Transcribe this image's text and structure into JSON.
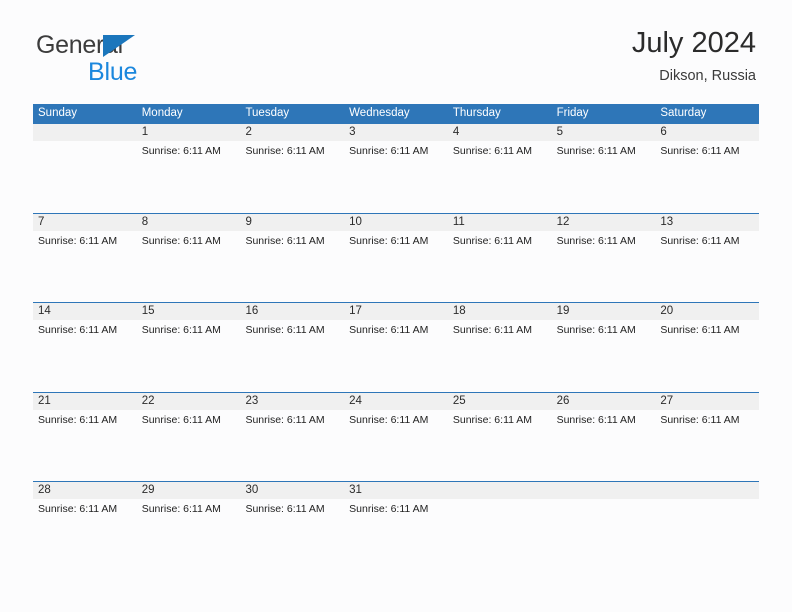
{
  "brand": {
    "line1": "General",
    "line2": "Blue",
    "triangle_color": "#1b76bc",
    "blue_text_color": "#1b87dd"
  },
  "header": {
    "title": "July 2024",
    "subtitle": "Dikson, Russia"
  },
  "colors": {
    "header_blue": "#2e76b8",
    "daynum_band": "#f0f0f0",
    "page_background": "#fcfcfd",
    "text": "#2b2b2b"
  },
  "calendar": {
    "weekday_headers": [
      "Sunday",
      "Monday",
      "Tuesday",
      "Wednesday",
      "Thursday",
      "Friday",
      "Saturday"
    ],
    "weeks": [
      {
        "days": [
          {
            "num": "",
            "event": ""
          },
          {
            "num": "1",
            "event": "Sunrise: 6:11 AM"
          },
          {
            "num": "2",
            "event": "Sunrise: 6:11 AM"
          },
          {
            "num": "3",
            "event": "Sunrise: 6:11 AM"
          },
          {
            "num": "4",
            "event": "Sunrise: 6:11 AM"
          },
          {
            "num": "5",
            "event": "Sunrise: 6:11 AM"
          },
          {
            "num": "6",
            "event": "Sunrise: 6:11 AM"
          }
        ]
      },
      {
        "days": [
          {
            "num": "7",
            "event": "Sunrise: 6:11 AM"
          },
          {
            "num": "8",
            "event": "Sunrise: 6:11 AM"
          },
          {
            "num": "9",
            "event": "Sunrise: 6:11 AM"
          },
          {
            "num": "10",
            "event": "Sunrise: 6:11 AM"
          },
          {
            "num": "11",
            "event": "Sunrise: 6:11 AM"
          },
          {
            "num": "12",
            "event": "Sunrise: 6:11 AM"
          },
          {
            "num": "13",
            "event": "Sunrise: 6:11 AM"
          }
        ]
      },
      {
        "days": [
          {
            "num": "14",
            "event": "Sunrise: 6:11 AM"
          },
          {
            "num": "15",
            "event": "Sunrise: 6:11 AM"
          },
          {
            "num": "16",
            "event": "Sunrise: 6:11 AM"
          },
          {
            "num": "17",
            "event": "Sunrise: 6:11 AM"
          },
          {
            "num": "18",
            "event": "Sunrise: 6:11 AM"
          },
          {
            "num": "19",
            "event": "Sunrise: 6:11 AM"
          },
          {
            "num": "20",
            "event": "Sunrise: 6:11 AM"
          }
        ]
      },
      {
        "days": [
          {
            "num": "21",
            "event": "Sunrise: 6:11 AM"
          },
          {
            "num": "22",
            "event": "Sunrise: 6:11 AM"
          },
          {
            "num": "23",
            "event": "Sunrise: 6:11 AM"
          },
          {
            "num": "24",
            "event": "Sunrise: 6:11 AM"
          },
          {
            "num": "25",
            "event": "Sunrise: 6:11 AM"
          },
          {
            "num": "26",
            "event": "Sunrise: 6:11 AM"
          },
          {
            "num": "27",
            "event": "Sunrise: 6:11 AM"
          }
        ]
      },
      {
        "days": [
          {
            "num": "28",
            "event": "Sunrise: 6:11 AM"
          },
          {
            "num": "29",
            "event": "Sunrise: 6:11 AM"
          },
          {
            "num": "30",
            "event": "Sunrise: 6:11 AM"
          },
          {
            "num": "31",
            "event": "Sunrise: 6:11 AM"
          },
          {
            "num": "",
            "event": ""
          },
          {
            "num": "",
            "event": ""
          },
          {
            "num": "",
            "event": ""
          }
        ]
      }
    ]
  }
}
